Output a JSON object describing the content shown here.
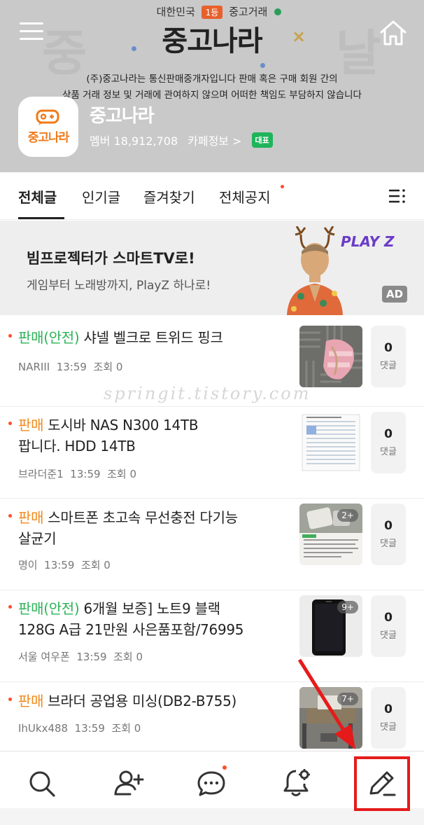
{
  "header": {
    "top_left_text": "대한민국",
    "top_badge": "1등",
    "top_right_text": "중고거래",
    "brand": "중고나라",
    "bg_left_text": "중",
    "bg_right_text": "날",
    "disclaimer_line1": "(주)중고나라는 통신판매중개자입니다 판매 혹은 구매 회원 간의",
    "disclaimer_line2": "상품 거래 정보 및 거래에 관여하지 않으며 어떠한 책임도 부담하지 않습니다",
    "cafe_logo_text": "중고나라",
    "cafe_name": "중고나라",
    "member_label": "멤버 18,912,708",
    "cafe_info": "카페정보 >",
    "rep_badge": "대표"
  },
  "tabs": [
    {
      "label": "전체글",
      "active": true
    },
    {
      "label": "인기글",
      "active": false
    },
    {
      "label": "즐겨찾기",
      "active": false
    },
    {
      "label": "전체공지",
      "active": false,
      "has_dot": true
    }
  ],
  "ad": {
    "title": "빔프로젝터가 스마트TV로!",
    "subtitle": "게임부터 노래방까지, PlayZ 하나로!",
    "brand": "PLAY Z",
    "badge": "AD"
  },
  "posts": [
    {
      "tag": "판매(안전)",
      "tag_type": "safe",
      "title_line1": " 샤넬 벨크로 트위드 핑크",
      "title_line2": "",
      "author": "NARIII",
      "time": "13:59",
      "views": "조회 0",
      "comments": "0",
      "comments_label": "댓글",
      "thumb_badge": ""
    },
    {
      "tag": "판매",
      "tag_type": "sell",
      "title_line1": " 도시바 NAS N300 14TB",
      "title_line2": "팝니다. HDD 14TB",
      "author": "브라더준1",
      "time": "13:59",
      "views": "조회 0",
      "comments": "0",
      "comments_label": "댓글",
      "thumb_badge": ""
    },
    {
      "tag": "판매",
      "tag_type": "sell",
      "title_line1": " 스마트폰 초고속 무선충전 다기능",
      "title_line2": "살균기",
      "author": "명이",
      "time": "13:59",
      "views": "조회 0",
      "comments": "0",
      "comments_label": "댓글",
      "thumb_badge": "2+"
    },
    {
      "tag": "판매(안전)",
      "tag_type": "safe",
      "title_line1": " 6개월 보증] 노트9 블랙",
      "title_line2": "128G A급 21만원 사은품포함/76995",
      "author": "서울 여우폰",
      "time": "13:59",
      "views": "조회 0",
      "comments": "0",
      "comments_label": "댓글",
      "thumb_badge": "9+"
    },
    {
      "tag": "판매",
      "tag_type": "sell",
      "title_line1": " 브라더 공업용 미싱(DB2-B755)",
      "title_line2": "",
      "author": "IhUkx488",
      "time": "13:59",
      "views": "조회 0",
      "comments": "0",
      "comments_label": "댓글",
      "thumb_badge": "7+"
    }
  ],
  "watermark": "springit.tistory.com",
  "bottom_nav": [
    {
      "icon": "search-icon"
    },
    {
      "icon": "add-member-icon"
    },
    {
      "icon": "chat-icon",
      "has_dot": true
    },
    {
      "icon": "notification-settings-icon"
    },
    {
      "icon": "write-icon"
    }
  ],
  "colors": {
    "accent_orange": "#f08a1c",
    "safe_green": "#2bb357",
    "new_dot": "#ff4d2a",
    "highlight_red": "#e51b1b",
    "playz_purple": "#6a3cc8"
  }
}
